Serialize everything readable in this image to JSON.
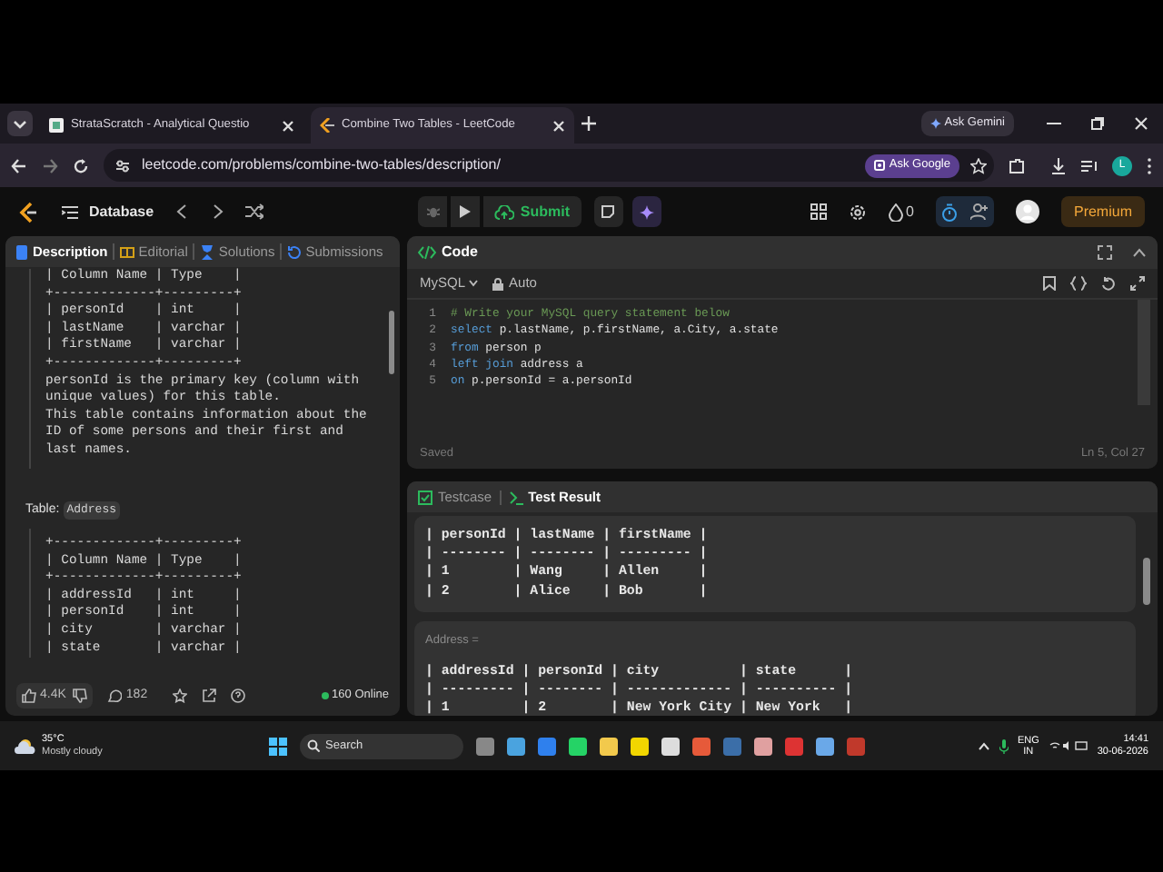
{
  "browser": {
    "tabs": [
      {
        "title": "StrataScratch - Analytical Questio",
        "selected": false
      },
      {
        "title": "Combine Two Tables - LeetCode",
        "selected": true
      }
    ],
    "ask_gemini": "Ask Gemini",
    "url": "leetcode.com/problems/combine-two-tables/description/",
    "ask_google": "Ask Google",
    "profile_initial": "L"
  },
  "toolbar": {
    "problem_list": "Database",
    "submit": "Submit",
    "streak": "0",
    "premium": "Premium"
  },
  "description": {
    "tabs": [
      {
        "label": "Description",
        "selected": true
      },
      {
        "label": "Editorial",
        "selected": false
      },
      {
        "label": "Solutions",
        "selected": false
      },
      {
        "label": "Submissions",
        "selected": false
      }
    ],
    "blocks": [
      {
        "kind": "pre",
        "lines": [
          "| Column Name | Type    |",
          "+-------------+---------+",
          "| personId    | int     |",
          "| lastName    | varchar |",
          "| firstName   | varchar |",
          "+-------------+---------+",
          "personId is the primary key (column with",
          "unique values) for this table.",
          "This table contains information about the",
          "ID of some persons and their first and",
          "last names."
        ]
      },
      {
        "kind": "table_label",
        "label": "Table:",
        "name": "Address"
      },
      {
        "kind": "pre",
        "lines": [
          "+-------------+---------+",
          "| Column Name | Type    |",
          "+-------------+---------+",
          "| addressId   | int     |",
          "| personId    | int     |",
          "| city        | varchar |",
          "| state       | varchar |"
        ]
      }
    ],
    "footer": {
      "likes": "4.4K",
      "comments": "182",
      "online": "160 Online"
    }
  },
  "code": {
    "title": "Code",
    "language": "MySQL",
    "mode": "Auto",
    "lines": [
      {
        "number": "1",
        "tokens": [
          {
            "kind": "comment",
            "text": "# Write your MySQL query statement below"
          }
        ]
      },
      {
        "number": "2",
        "tokens": [
          {
            "kind": "keyword",
            "text": "select"
          },
          {
            "kind": "plain",
            "text": " p.lastName, p.firstName, a.City, a.state"
          }
        ]
      },
      {
        "number": "3",
        "tokens": [
          {
            "kind": "keyword",
            "text": "from"
          },
          {
            "kind": "plain",
            "text": " person p"
          }
        ]
      },
      {
        "number": "4",
        "tokens": [
          {
            "kind": "keyword",
            "text": "left join"
          },
          {
            "kind": "plain",
            "text": " address a"
          }
        ]
      },
      {
        "number": "5",
        "tokens": [
          {
            "kind": "keyword",
            "text": "on"
          },
          {
            "kind": "plain",
            "text": " p.personId = a.personId"
          }
        ]
      }
    ],
    "saved": "Saved",
    "cursor": "Ln 5, Col 27"
  },
  "result": {
    "tabs": [
      {
        "label": "Testcase",
        "selected": false
      },
      {
        "label": "Test Result",
        "selected": true
      }
    ],
    "cards": [
      {
        "lines": [
          "| personId | lastName | firstName |",
          "| -------- | -------- | --------- |",
          "| 1        | Wang     | Allen     |",
          "| 2        | Alice    | Bob       |"
        ]
      },
      {
        "label": "Address =",
        "lines": [
          "| addressId | personId | city          | state      |",
          "| --------- | -------- | ------------- | ---------- |",
          "| 1         | 2        | New York City | New York   |"
        ]
      }
    ]
  },
  "taskbar": {
    "temperature": "35°C",
    "weather": "Mostly cloudy",
    "search": "Search",
    "language": "ENG",
    "region": "IN",
    "time": "14:41",
    "date": "30-06-2026"
  }
}
